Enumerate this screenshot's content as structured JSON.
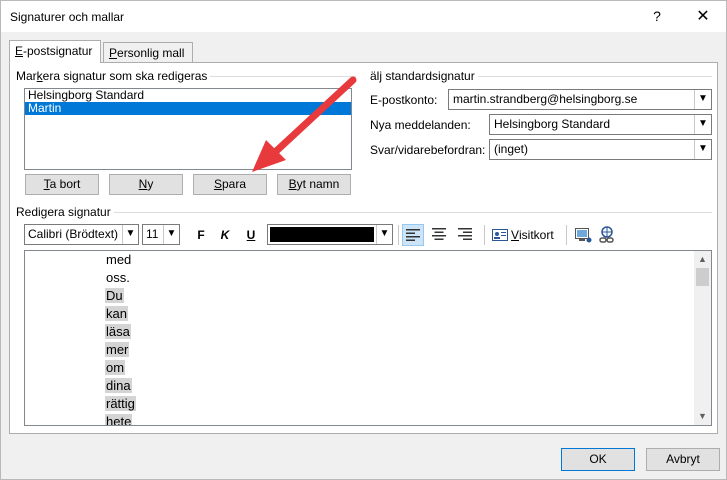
{
  "window": {
    "title": "Signaturer och mallar",
    "help_glyph": "?",
    "close_glyph": "✕"
  },
  "tabs": [
    {
      "label": "E-postsignatur",
      "mnemonic": "E",
      "rest": "-postsignatur",
      "active": true
    },
    {
      "label": "Personlig mall",
      "mnemonic": "P",
      "rest": "ersonlig mall",
      "active": false
    }
  ],
  "edit_section": {
    "label_pre": "Mar",
    "label_mnemonic": "k",
    "label_post": "era signatur som ska redigeras"
  },
  "signatures": [
    {
      "name": "Helsingborg Standard",
      "selected": false
    },
    {
      "name": "Martin",
      "selected": true
    }
  ],
  "buttons": {
    "delete": {
      "mnemonic": "T",
      "rest": "a bort"
    },
    "new": {
      "mnemonic": "N",
      "rest": "y"
    },
    "save": {
      "mnemonic": "S",
      "rest": "para"
    },
    "rename": {
      "mnemonic": "B",
      "rest": "yt namn"
    }
  },
  "default_section": {
    "label": "älj standardsignatur"
  },
  "account": {
    "label": "E-postkonto:",
    "value": "martin.strandberg@helsingborg.se"
  },
  "new_messages": {
    "label": "Nya meddelanden:",
    "value": "Helsingborg Standard"
  },
  "replies": {
    "label": "Svar/vidarebefordran:",
    "value": "(inget)"
  },
  "editor_section": {
    "label": "Redigera signatur"
  },
  "toolbar": {
    "font": "Calibri (Brödtext)",
    "size": "11",
    "bold": "F",
    "italic": "K",
    "underline": "U",
    "font_color": "#000000",
    "business_card_mnemonic": "V",
    "business_card_rest": "isitkort"
  },
  "editor_lines": [
    {
      "text": "med",
      "highlight": false
    },
    {
      "text": "oss.",
      "highlight": false
    },
    {
      "text": "Du",
      "highlight": true
    },
    {
      "text": "kan",
      "highlight": true
    },
    {
      "text": "läsa",
      "highlight": true
    },
    {
      "text": "mer",
      "highlight": true
    },
    {
      "text": "om",
      "highlight": true
    },
    {
      "text": "dina",
      "highlight": true
    },
    {
      "text": "rättig",
      "highlight": true
    },
    {
      "text": "hete",
      "highlight": true
    }
  ],
  "footer": {
    "ok": "OK",
    "cancel": "Avbryt"
  },
  "colors": {
    "accent": "#0078d7",
    "annotation_arrow": "#e8393c"
  }
}
